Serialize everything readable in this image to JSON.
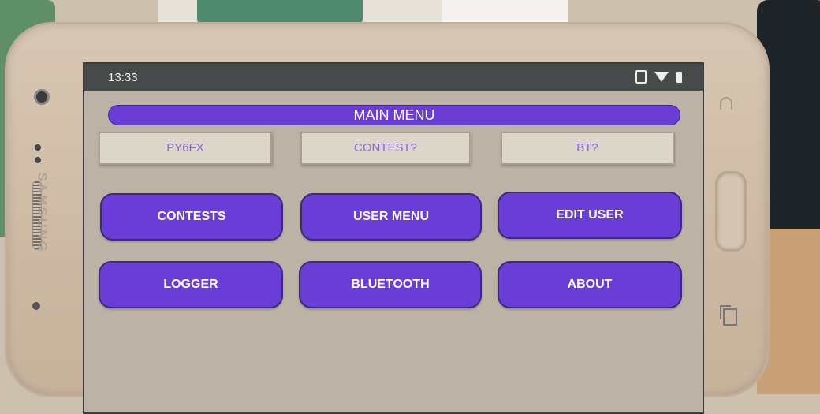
{
  "status_bar": {
    "time": "13:33",
    "icons": [
      "vibrate-icon",
      "wifi-icon",
      "battery-icon"
    ]
  },
  "app": {
    "title": "MAIN MENU",
    "info_fields": [
      {
        "label": "PY6FX"
      },
      {
        "label": "CONTEST?"
      },
      {
        "label": "BT?"
      }
    ],
    "buttons": [
      {
        "label": "CONTESTS"
      },
      {
        "label": "USER MENU"
      },
      {
        "label": "EDIT USER"
      },
      {
        "label": "LOGGER"
      },
      {
        "label": "BLUETOOTH"
      },
      {
        "label": "ABOUT"
      }
    ]
  },
  "device": {
    "brand": "SAMSUNG"
  },
  "colors": {
    "accent": "#6a3ed6",
    "info_text": "#8a64d6",
    "status_bar": "#474a4b"
  }
}
